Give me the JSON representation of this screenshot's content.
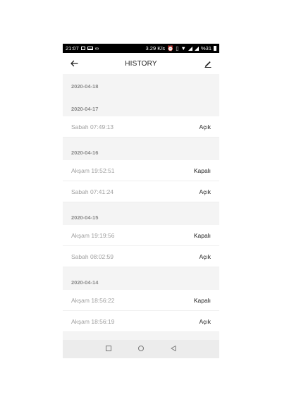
{
  "status_bar": {
    "time": "21:07",
    "speed": "3.29 K/s",
    "battery": "%31",
    "icons": [
      "image-icon",
      "laptop-icon",
      "link-icon",
      "alarm-icon",
      "vibrate-icon",
      "wifi-icon",
      "signal-icon",
      "battery-icon"
    ]
  },
  "app_bar": {
    "title": "HISTORY",
    "back_icon": "arrow-left-icon",
    "edit_icon": "pencil-icon"
  },
  "history": [
    {
      "date": "2020-04-18",
      "entries": []
    },
    {
      "date": "2020-04-17",
      "entries": [
        {
          "time": "Sabah  07:49:13",
          "state": "Açık"
        }
      ]
    },
    {
      "date": "2020-04-16",
      "entries": [
        {
          "time": "Akşam  19:52:51",
          "state": "Kapalı"
        },
        {
          "time": "Sabah  07:41:24",
          "state": "Açık"
        }
      ]
    },
    {
      "date": "2020-04-15",
      "entries": [
        {
          "time": "Akşam  19:19:56",
          "state": "Kapalı"
        },
        {
          "time": "Sabah  08:02:59",
          "state": "Açık"
        }
      ]
    },
    {
      "date": "2020-04-14",
      "entries": [
        {
          "time": "Akşam  18:56:22",
          "state": "Kapalı"
        },
        {
          "time": "Akşam  18:56:19",
          "state": "Açık"
        }
      ]
    }
  ],
  "nav_bar": {
    "icons": [
      "recents-square-icon",
      "home-circle-icon",
      "back-triangle-icon"
    ]
  }
}
